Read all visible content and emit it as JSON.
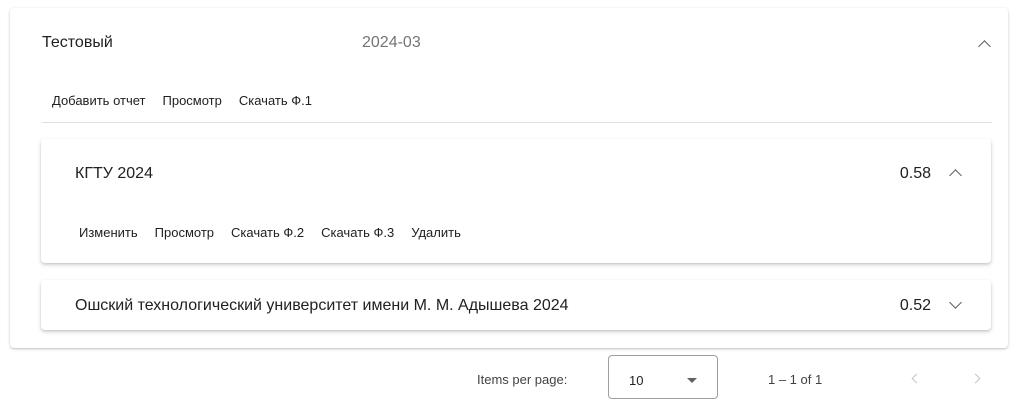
{
  "report": {
    "title": "Тестовый",
    "date": "2024-03",
    "expanded_icon": "chevron-up-icon",
    "actions": {
      "add_report": "Добавить отчет",
      "view": "Просмотр",
      "download_f1": "Скачать Ф.1"
    },
    "items": [
      {
        "name": "КГТУ 2024",
        "score": "0.58",
        "expanded": true,
        "icon": "chevron-up-icon",
        "actions": {
          "edit": "Изменить",
          "view": "Просмотр",
          "download_f2": "Скачать Ф.2",
          "download_f3": "Скачать Ф.3",
          "delete": "Удалить"
        }
      },
      {
        "name": "Ошский технологический университет имени М. М. Адышева 2024",
        "score": "0.52",
        "expanded": false,
        "icon": "chevron-down-icon"
      }
    ]
  },
  "paginator": {
    "items_per_page_label": "Items per page:",
    "items_per_page_value": "10",
    "range_label": "1 – 1 of 1",
    "prev_icon": "chevron-left-icon",
    "next_icon": "chevron-right-icon"
  }
}
